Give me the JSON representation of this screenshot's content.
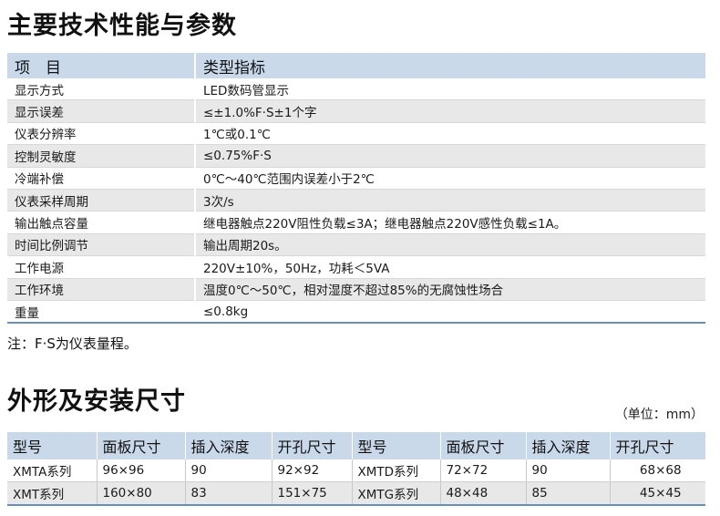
{
  "section1": {
    "title": "主要技术性能与参数",
    "header": [
      "项　目",
      "类型指标"
    ],
    "rows": [
      [
        "显示方式",
        "LED数码管显示"
      ],
      [
        "显示误差",
        "≤±1.0%F·S±1个字"
      ],
      [
        "仪表分辨率",
        "1℃或0.1℃"
      ],
      [
        "控制灵敏度",
        "≤0.75%F·S"
      ],
      [
        "冷端补偿",
        "0℃～40℃范围内误差小于2℃"
      ],
      [
        "仪表采样周期",
        "3次/s"
      ],
      [
        "输出触点容量",
        "继电器触点220V阻性负载≤3A；继电器触点220V感性负载≤1A。"
      ],
      [
        "时间比例调节",
        "输出周期20s。"
      ],
      [
        "工作电源",
        "220V±10%，50Hz，功耗＜5VA"
      ],
      [
        "工作环境",
        "温度0℃～50℃，相对湿度不超过85%的无腐蚀性场合"
      ],
      [
        "重量",
        "≤0.8kg"
      ]
    ],
    "note": "注：F·S为仪表量程。"
  },
  "section2": {
    "title": "外形及安装尺寸",
    "unit": "（单位：mm）",
    "header": [
      "型号",
      "面板尺寸",
      "插入深度",
      "开孔尺寸",
      "型号",
      "面板尺寸",
      "插入深度",
      "开孔尺寸"
    ],
    "rows": [
      [
        "XMTA系列",
        "96×96",
        "90",
        "92×92",
        "XMTD系列",
        "72×72",
        "90",
        "68×68"
      ],
      [
        "XMT系列",
        "160×80",
        "83",
        "151×75",
        "XMTG系列",
        "48×48",
        "85",
        "45×45"
      ]
    ]
  }
}
